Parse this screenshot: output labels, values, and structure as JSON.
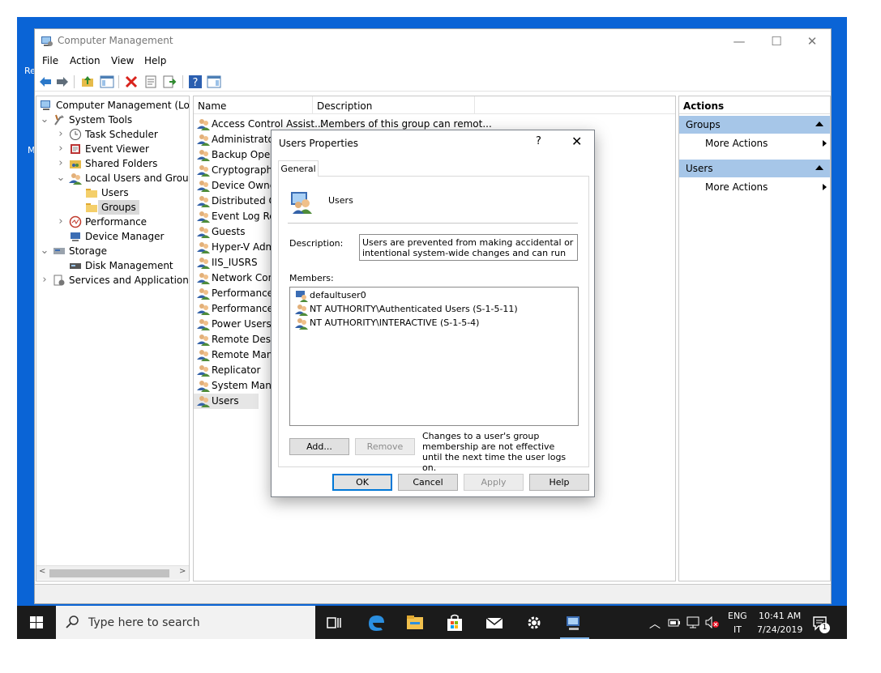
{
  "window": {
    "title": "Computer Management",
    "menu": [
      "File",
      "Action",
      "View",
      "Help"
    ]
  },
  "tree": [
    {
      "label": "Computer Management (Local",
      "indent": 0,
      "twisty": "",
      "icon": "computer-management-icon"
    },
    {
      "label": "System Tools",
      "indent": 1,
      "twisty": "v",
      "icon": "system-tools-icon"
    },
    {
      "label": "Task Scheduler",
      "indent": 2,
      "twisty": ">",
      "icon": "clock-icon"
    },
    {
      "label": "Event Viewer",
      "indent": 2,
      "twisty": ">",
      "icon": "event-viewer-icon"
    },
    {
      "label": "Shared Folders",
      "indent": 2,
      "twisty": ">",
      "icon": "shared-folder-icon"
    },
    {
      "label": "Local Users and Groups",
      "indent": 2,
      "twisty": "v",
      "icon": "users-group-icon"
    },
    {
      "label": "Users",
      "indent": 3,
      "twisty": "",
      "icon": "folder-icon"
    },
    {
      "label": "Groups",
      "indent": 3,
      "twisty": "",
      "icon": "folder-icon"
    },
    {
      "label": "Performance",
      "indent": 2,
      "twisty": ">",
      "icon": "performance-icon"
    },
    {
      "label": "Device Manager",
      "indent": 2,
      "twisty": "",
      "icon": "device-manager-icon"
    },
    {
      "label": "Storage",
      "indent": 1,
      "twisty": "v",
      "icon": "storage-icon"
    },
    {
      "label": "Disk Management",
      "indent": 2,
      "twisty": "",
      "icon": "disk-icon"
    },
    {
      "label": "Services and Applications",
      "indent": 1,
      "twisty": ">",
      "icon": "services-icon"
    }
  ],
  "list": {
    "columns": [
      "Name",
      "Description"
    ],
    "rows": [
      {
        "name": "Access Control Assist...",
        "desc": "Members of this group can remot..."
      },
      {
        "name": "Administrators",
        "desc": ""
      },
      {
        "name": "Backup Operat",
        "desc": ""
      },
      {
        "name": "Cryptographic",
        "desc": ""
      },
      {
        "name": "Device Owners",
        "desc": ""
      },
      {
        "name": "Distributed CC",
        "desc": ""
      },
      {
        "name": "Event Log Rea",
        "desc": ""
      },
      {
        "name": "Guests",
        "desc": ""
      },
      {
        "name": "Hyper-V Admi",
        "desc": ""
      },
      {
        "name": "IIS_IUSRS",
        "desc": ""
      },
      {
        "name": "Network Confi",
        "desc": ""
      },
      {
        "name": "Performance L",
        "desc": ""
      },
      {
        "name": "Performance M",
        "desc": ""
      },
      {
        "name": "Power Users",
        "desc": ""
      },
      {
        "name": "Remote Deskto",
        "desc": ""
      },
      {
        "name": "Remote Manag",
        "desc": ""
      },
      {
        "name": "Replicator",
        "desc": ""
      },
      {
        "name": "System Manag",
        "desc": ""
      },
      {
        "name": "Users",
        "desc": ""
      }
    ]
  },
  "actions": {
    "title": "Actions",
    "sections": [
      {
        "header": "Groups",
        "item": "More Actions"
      },
      {
        "header": "Users",
        "item": "More Actions"
      }
    ]
  },
  "dialog": {
    "title": "Users Properties",
    "help": "?",
    "close": "✕",
    "tab": "General",
    "group_name": "Users",
    "description_label": "Description:",
    "description_value": "Users are prevented from making accidental or intentional system-wide changes and can run most",
    "members_label": "Members:",
    "members": [
      "defaultuser0",
      "NT AUTHORITY\\Authenticated Users (S-1-5-11)",
      "NT AUTHORITY\\INTERACTIVE (S-1-5-4)"
    ],
    "add_label": "Add...",
    "remove_label": "Remove",
    "note": "Changes to a user's group membership are not effective until the next time the user logs on.",
    "ok_label": "OK",
    "cancel_label": "Cancel",
    "apply_label": "Apply",
    "help_label": "Help"
  },
  "taskbar": {
    "search_placeholder": "Type here to search",
    "lang_top": "ENG",
    "lang_bottom": "IT",
    "time": "10:41 AM",
    "date": "7/24/2019",
    "notification_count": "1"
  },
  "desktop": {
    "frag1": "Re",
    "frag2": "M"
  },
  "colors": {
    "accent": "#0078d7",
    "actions_header": "#a6c6e8",
    "desktop": "#0a64d6",
    "taskbar": "#1b1b1b"
  }
}
